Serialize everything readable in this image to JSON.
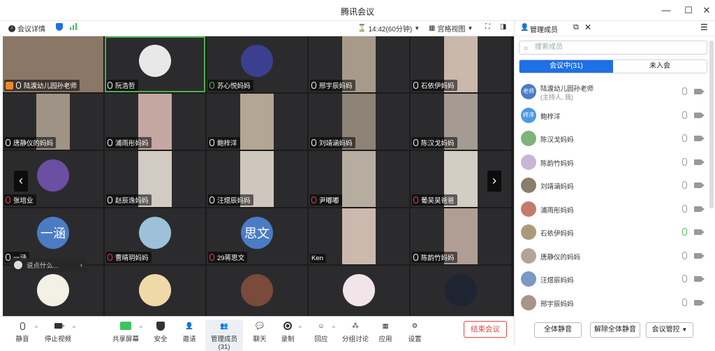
{
  "window": {
    "title": "腾讯会议"
  },
  "toolbar": {
    "meeting_info": "会议详情",
    "timer": "14:42(60分钟)",
    "view": "宫格视图"
  },
  "grid": {
    "tiles": [
      {
        "name": "陆渡幼儿园孙老师",
        "row": 0,
        "col": 0,
        "type": "video",
        "bg": "#8a7766",
        "mic": "on",
        "host": true
      },
      {
        "name": "阮浩哲",
        "row": 0,
        "col": 1,
        "type": "avatar",
        "avcolor": "#e8e8e8",
        "mic": "on",
        "active": true
      },
      {
        "name": "苏心悦妈妈",
        "row": 0,
        "col": 2,
        "type": "avatar",
        "avcolor": "#3a3f8f",
        "mic": "green"
      },
      {
        "name": "邢宇辰妈妈",
        "row": 0,
        "col": 3,
        "type": "video",
        "bg": "#a79a8a",
        "mic": "on"
      },
      {
        "name": "石依伊妈妈",
        "row": 0,
        "col": 4,
        "type": "video",
        "bg": "#c9b8ab",
        "mic": "on"
      },
      {
        "name": "唐静仪的妈妈",
        "row": 1,
        "col": 0,
        "type": "video",
        "bg": "#9e9385",
        "mic": "on"
      },
      {
        "name": "浦雨彤妈妈",
        "row": 1,
        "col": 1,
        "type": "video",
        "bg": "#c4a7a0",
        "mic": "on"
      },
      {
        "name": "鲍梓洋",
        "row": 1,
        "col": 2,
        "type": "video",
        "bg": "#b3a693",
        "mic": "on"
      },
      {
        "name": "刘靖涵妈妈",
        "row": 1,
        "col": 3,
        "type": "video",
        "bg": "#8d8276",
        "mic": "on"
      },
      {
        "name": "陈汉戈妈妈",
        "row": 1,
        "col": 4,
        "type": "video",
        "bg": "#a69b92",
        "mic": "on"
      },
      {
        "name": "张培业",
        "row": 2,
        "col": 0,
        "type": "avatar",
        "avcolor": "#6a4fa3",
        "mic": "off"
      },
      {
        "name": "赵辰逸妈妈",
        "row": 2,
        "col": 1,
        "type": "video",
        "bg": "#d1cbc3",
        "mic": "on"
      },
      {
        "name": "汪煜辰妈妈",
        "row": 2,
        "col": 2,
        "type": "video",
        "bg": "#cfc7bd",
        "mic": "on"
      },
      {
        "name": "尹嘟嘟",
        "row": 2,
        "col": 3,
        "type": "video",
        "bg": "#b7aca0",
        "mic": "off"
      },
      {
        "name": "葡吴昊爸爸",
        "row": 2,
        "col": 4,
        "type": "video",
        "bg": "#d3cdc4",
        "mic": "off"
      },
      {
        "name": "一涵",
        "row": 3,
        "col": 0,
        "type": "text",
        "avtext": "一涵",
        "mic": "on"
      },
      {
        "name": "曹晴玥妈妈",
        "row": 3,
        "col": 1,
        "type": "avatar",
        "avcolor": "#9cc1d8",
        "mic": "off"
      },
      {
        "name": "29蒋思文",
        "row": 3,
        "col": 2,
        "type": "text",
        "avtext": "思文",
        "mic": "off"
      },
      {
        "name": "Ken",
        "row": 3,
        "col": 3,
        "type": "video",
        "bg": "#cbb9ae",
        "mic": "none"
      },
      {
        "name": "陈韵竹妈妈",
        "row": 3,
        "col": 4,
        "type": "video",
        "bg": "#b09e94",
        "mic": "on"
      },
      {
        "name": "",
        "row": 4,
        "col": 0,
        "type": "avatar",
        "avcolor": "#f3f0e6",
        "mic": "none"
      },
      {
        "name": "",
        "row": 4,
        "col": 1,
        "type": "avatar",
        "avcolor": "#f0d9a8",
        "mic": "none"
      },
      {
        "name": "",
        "row": 4,
        "col": 2,
        "type": "avatar",
        "avcolor": "#7a4a3a",
        "mic": "none"
      },
      {
        "name": "",
        "row": 4,
        "col": 3,
        "type": "avatar",
        "avcolor": "#f2e5ea",
        "mic": "none"
      },
      {
        "name": "",
        "row": 4,
        "col": 4,
        "type": "avatar",
        "avcolor": "#1f2433",
        "mic": "none"
      }
    ]
  },
  "chat": {
    "placeholder": "说点什么..."
  },
  "bottom": {
    "mute": "静音",
    "stop_video": "停止视频",
    "share": "共享屏幕",
    "security": "安全",
    "invite": "邀请",
    "manage": "管理成员(31)",
    "chat": "聊天",
    "record": "录制",
    "react": "回应",
    "breakout": "分组讨论",
    "apps": "应用",
    "settings": "设置",
    "end": "结束会议"
  },
  "panel": {
    "title": "管理成员",
    "search_placeholder": "搜索成员",
    "tab_in": "会议中(31)",
    "tab_out": "未入会",
    "members": [
      {
        "name": "陆渡幼儿园孙老师",
        "sub": "(主持人, 我)",
        "avtext": "老师",
        "avcolor": "#4a7cc4",
        "mic": "gray"
      },
      {
        "name": "鲍梓洋",
        "avtext": "梓洋",
        "avcolor": "#4a9ae0",
        "mic": "gray"
      },
      {
        "name": "陈汉戈妈妈",
        "avtext": "",
        "avcolor": "#7fb37a",
        "mic": "gray"
      },
      {
        "name": "陈韵竹妈妈",
        "avtext": "",
        "avcolor": "#c7b6d6",
        "mic": "gray"
      },
      {
        "name": "刘靖涵妈妈",
        "avtext": "",
        "avcolor": "#8a7d6b",
        "mic": "gray"
      },
      {
        "name": "浦雨彤妈妈",
        "avtext": "",
        "avcolor": "#c47a6d",
        "mic": "gray"
      },
      {
        "name": "石依伊妈妈",
        "avtext": "",
        "avcolor": "#a99b7a",
        "mic": "green"
      },
      {
        "name": "唐静仪的妈妈",
        "avtext": "",
        "avcolor": "#b5a39a",
        "mic": "gray"
      },
      {
        "name": "汪煜辰妈妈",
        "avtext": "",
        "avcolor": "#7a99c4",
        "mic": "gray"
      },
      {
        "name": "邢宇辰妈妈",
        "avtext": "",
        "avcolor": "#a9938a",
        "mic": "gray"
      }
    ],
    "mute_all": "全体静音",
    "unmute_all": "解除全体静音",
    "control": "会议管控"
  }
}
